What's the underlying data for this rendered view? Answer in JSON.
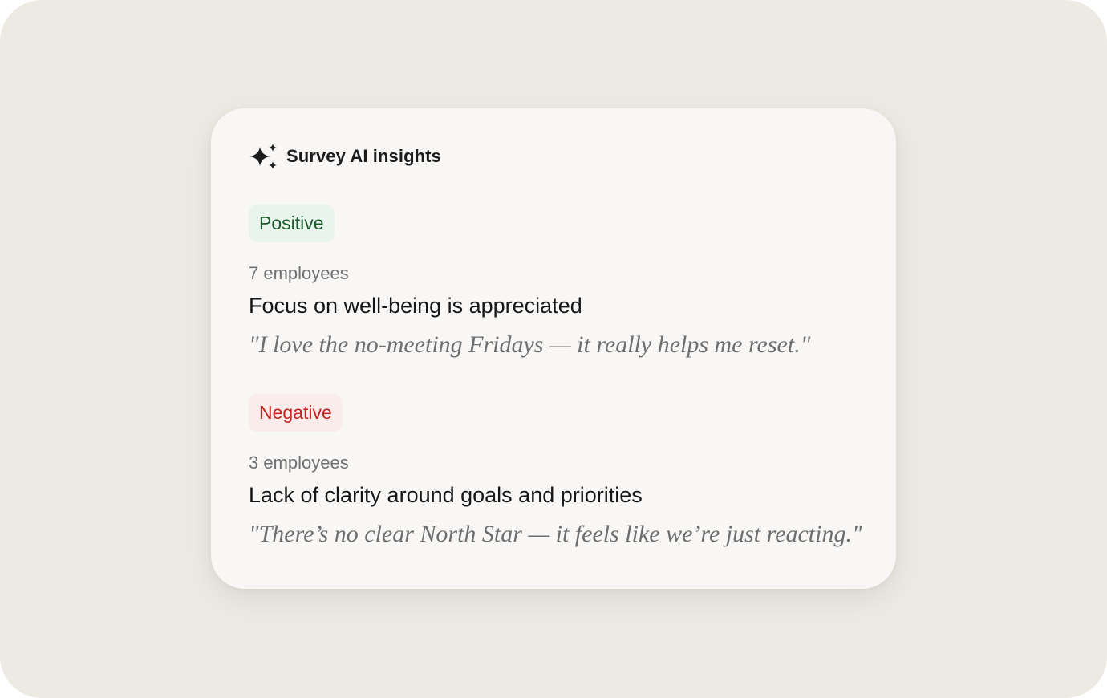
{
  "card": {
    "title": "Survey AI insights",
    "title_icon": "sparkles-icon"
  },
  "sections": [
    {
      "sentiment": "Positive",
      "sentiment_color": "#1b5a2c",
      "sentiment_bg": "#e9f5ec",
      "count": "7 employees",
      "theme": "Focus on well-being is appreciated",
      "quote": "\"I love the no-meeting Fridays — it really helps me reset.\""
    },
    {
      "sentiment": "Negative",
      "sentiment_color": "#c3241f",
      "sentiment_bg": "#fbecec",
      "count": "3 employees",
      "theme": "Lack of clarity around goals and priorities",
      "quote": "\"There’s no clear North Star — it feels like we’re just reacting.\""
    }
  ]
}
